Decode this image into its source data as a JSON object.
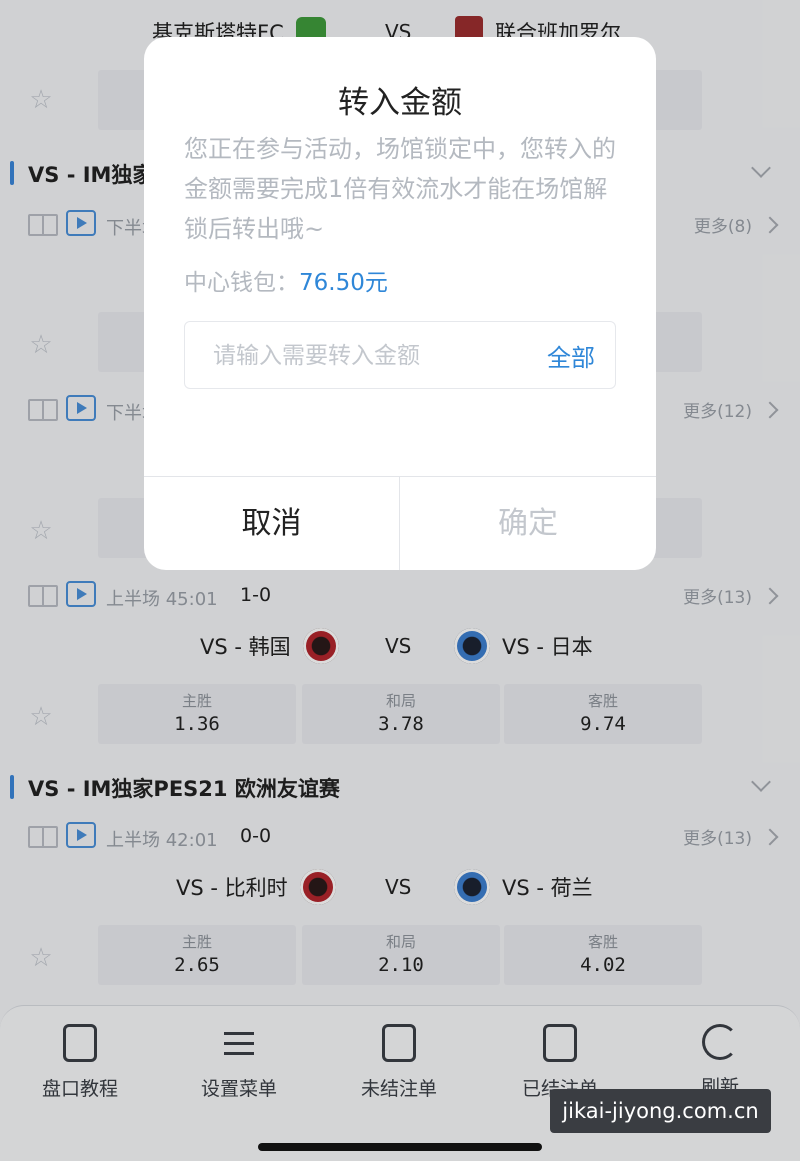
{
  "top_match": {
    "home": "基克斯塔特FC",
    "vs": "VS",
    "away": "联合班加罗尔"
  },
  "league1": {
    "name": "VS - IM独家"
  },
  "match2": {
    "time": "下半场",
    "more": "更多(8)"
  },
  "match3": {
    "time": "下半场",
    "more": "更多(12)"
  },
  "match4": {
    "time": "上半场 45:01",
    "score": "1-0",
    "more": "更多(13)",
    "home": "VS - 韩国",
    "vs": "VS",
    "away": "VS - 日本",
    "odds": [
      {
        "label": "主胜",
        "value": "1.36"
      },
      {
        "label": "和局",
        "value": "3.78"
      },
      {
        "label": "客胜",
        "value": "9.74"
      }
    ]
  },
  "league2": {
    "name": "VS - IM独家PES21 欧洲友谊赛"
  },
  "match5": {
    "time": "上半场 42:01",
    "score": "0-0",
    "more": "更多(13)",
    "home": "VS - 比利时",
    "vs": "VS",
    "away": "VS - 荷兰",
    "odds": [
      {
        "label": "主胜",
        "value": "2.65"
      },
      {
        "label": "和局",
        "value": "2.10"
      },
      {
        "label": "客胜",
        "value": "4.02"
      }
    ]
  },
  "nav": [
    {
      "label": "盘口教程",
      "icon": "document-icon"
    },
    {
      "label": "设置菜单",
      "icon": "sliders-icon"
    },
    {
      "label": "未结注单",
      "icon": "clipboard-icon"
    },
    {
      "label": "已结注单",
      "icon": "yen-clipboard-icon"
    },
    {
      "label": "刷新",
      "icon": "refresh-icon"
    }
  ],
  "watermark": "jikai-jiyong.com.cn",
  "modal": {
    "title": "转入金额",
    "message": "您正在参与活动，场馆锁定中，您转入的金额需要完成1倍有效流水才能在场馆解锁后转出哦~",
    "wallet_label": "中心钱包：",
    "wallet_amount": "76.50元",
    "input_placeholder": "请输入需要转入金额",
    "all_label": "全部",
    "cancel_label": "取消",
    "confirm_label": "确定"
  },
  "colors": {
    "accent": "#2f87d8",
    "league_bar": "#3b86d9"
  }
}
